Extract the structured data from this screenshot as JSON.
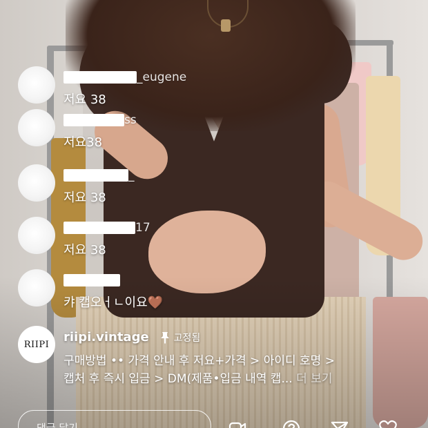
{
  "comments": [
    {
      "username_visible": "_eugene",
      "text": "저요 38"
    },
    {
      "username_visible": "ss",
      "text": "저요38"
    },
    {
      "username_visible": "_",
      "text": "저요 38"
    },
    {
      "username_visible": "17",
      "text": "저요 38"
    },
    {
      "username_visible": "",
      "text": "캬 캡오ㅓㄴ이요🤎"
    }
  ],
  "pinned": {
    "logo_text": "RIIPI",
    "username": "riipi.vintage",
    "pin_label": "고정됨",
    "line1": "구매방법 •• 가격 안내 후 저요+가격 > 아이디 호명 >",
    "line2": "캡처 후 즉시 입금 > DM(제품•입금 내역 캡...",
    "more_label": "더 보기"
  },
  "bottom_bar": {
    "comment_placeholder": "댓글 달기...",
    "icons": [
      "add-video-icon",
      "question-icon",
      "send-icon",
      "heart-icon"
    ]
  },
  "colors": {
    "overlay_text": "#ffffff",
    "more_text": "#bfbfbf"
  }
}
